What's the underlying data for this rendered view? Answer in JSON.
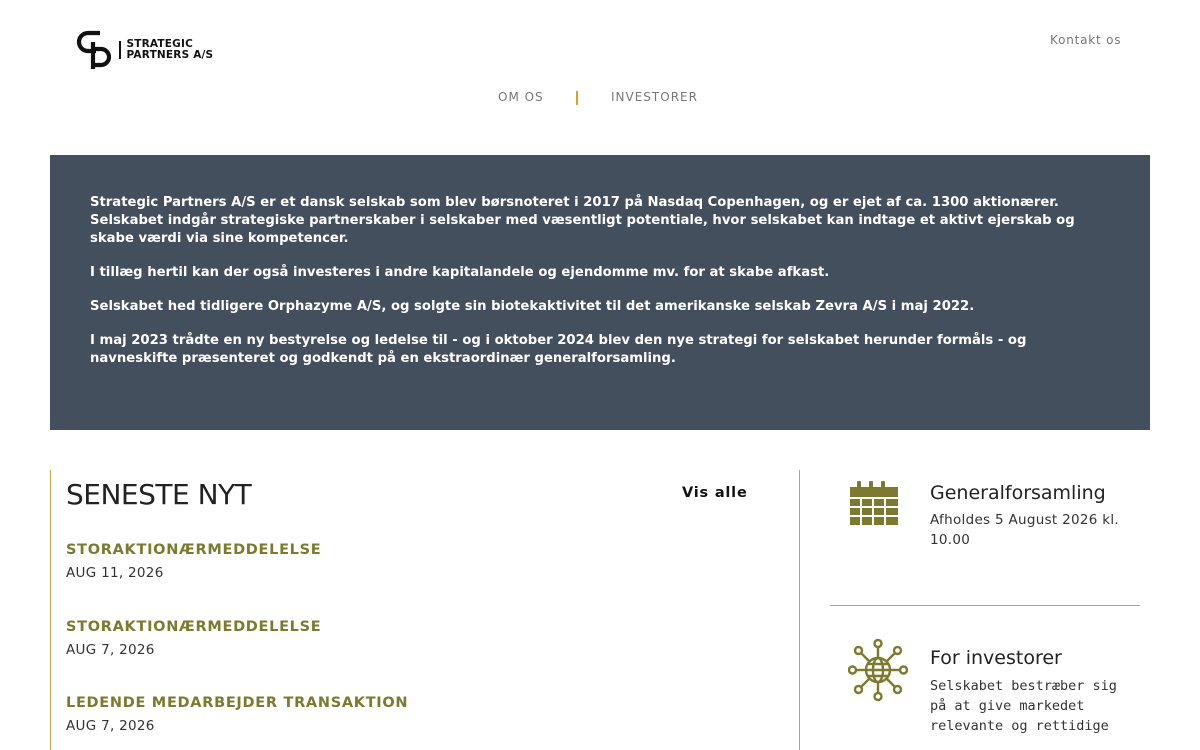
{
  "brand": {
    "line1": "STRATEGIC",
    "line2": "PARTNERS A/S",
    "logo_icon": "sp-monogram-icon"
  },
  "header": {
    "contact_label": "Kontakt os"
  },
  "nav": {
    "items": [
      {
        "label": "OM OS"
      },
      {
        "label": "INVESTORER"
      }
    ],
    "separator_color": "#e0a030"
  },
  "intro": {
    "background": "#444f5d",
    "paragraphs": [
      "Strategic Partners A/S er et dansk selskab som blev børsnoteret i 2017 på Nasdaq Copenhagen, og er ejet af ca. 1300 aktionærer. Selskabet indgår strategiske partnerskaber i selskaber med væsentligt potentiale, hvor selskabet kan indtage et aktivt ejerskab og skabe værdi via sine kompetencer.",
      "I tillæg hertil kan der også investeres i andre kapitalandele og ejendomme mv. for at skabe afkast.",
      "Selskabet hed tidligere Orphazyme A/S, og solgte sin biotekaktivitet til det amerikanske selskab Zevra A/S i maj 2022.",
      "I maj 2023 trådte en ny bestyrelse og ledelse til - og i oktober 2024 blev den nye strategi for selskabet herunder formåls - og navneskifte præsenteret og godkendt på en ekstraordinær generalforsamling."
    ]
  },
  "news": {
    "title": "SENESTE NYT",
    "see_all_label": "Vis alle",
    "accent": "#7b7a2e",
    "items": [
      {
        "title": "STORAKTIONÆRMEDDELELSE",
        "date": "AUG 11, 2026"
      },
      {
        "title": "STORAKTIONÆRMEDDELELSE",
        "date": "AUG 7, 2026"
      },
      {
        "title": "LEDENDE MEDARBEJDER TRANSAKTION",
        "date": "AUG 7, 2026"
      }
    ]
  },
  "cards": {
    "general_meeting": {
      "icon": "calendar-icon",
      "title": "Generalforsamling",
      "text": "Afholdes 5 August 2026 kl. 10.00"
    },
    "investors": {
      "icon": "globe-network-icon",
      "title": "For investorer",
      "text": "Selskabet bestræber sig på at give markedet relevante og rettidige"
    },
    "icon_color": "#7b7a2e",
    "divider_color": "#c8a24a"
  }
}
